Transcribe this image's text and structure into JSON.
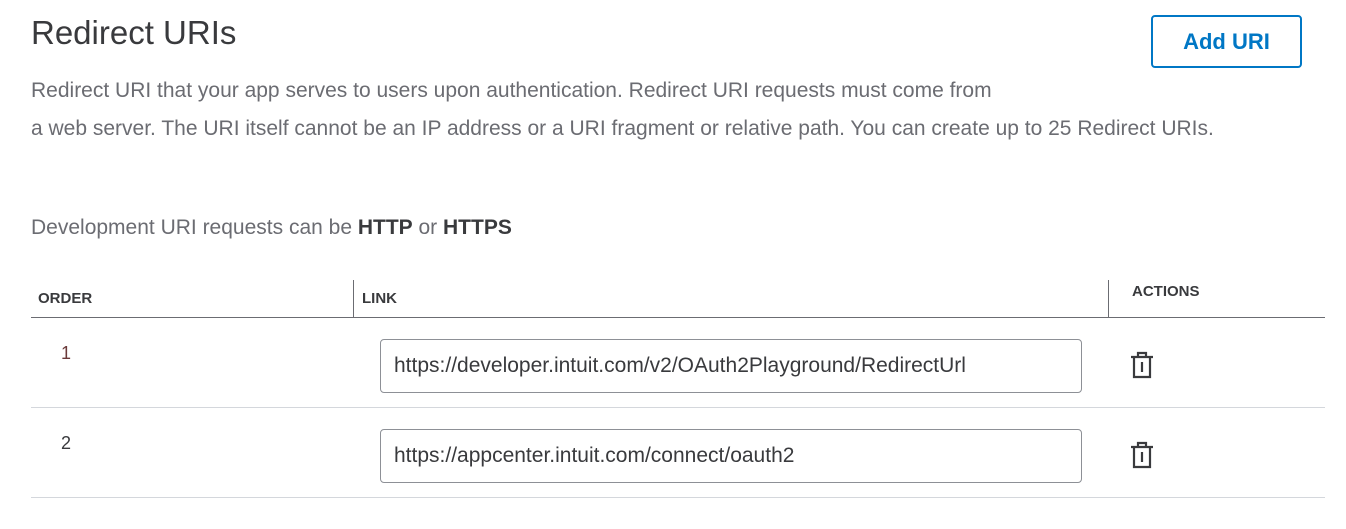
{
  "title": "Redirect URIs",
  "add_button": "Add URI",
  "description": {
    "line1": "Redirect URI that your app serves to users upon authentication. Redirect URI requests must come from",
    "line2": "a web server. The URI itself cannot be an IP address or a URI fragment or relative path. You can create up to 25 Redirect URIs."
  },
  "dev_note": {
    "prefix": "Development URI requests can be ",
    "http": "HTTP",
    "or": " or ",
    "https": "HTTPS"
  },
  "table": {
    "headers": {
      "order": "ORDER",
      "link": "LINK",
      "actions": "ACTIONS"
    },
    "rows": [
      {
        "order": "1",
        "link": "https://developer.intuit.com/v2/OAuth2Playground/RedirectUrl",
        "action_icon": "trash-icon"
      },
      {
        "order": "2",
        "link": "https://appcenter.intuit.com/connect/oauth2",
        "action_icon": "trash-icon"
      }
    ]
  },
  "colors": {
    "accent": "#0077c5",
    "text": "#393a3d",
    "muted": "#6b6c72"
  }
}
